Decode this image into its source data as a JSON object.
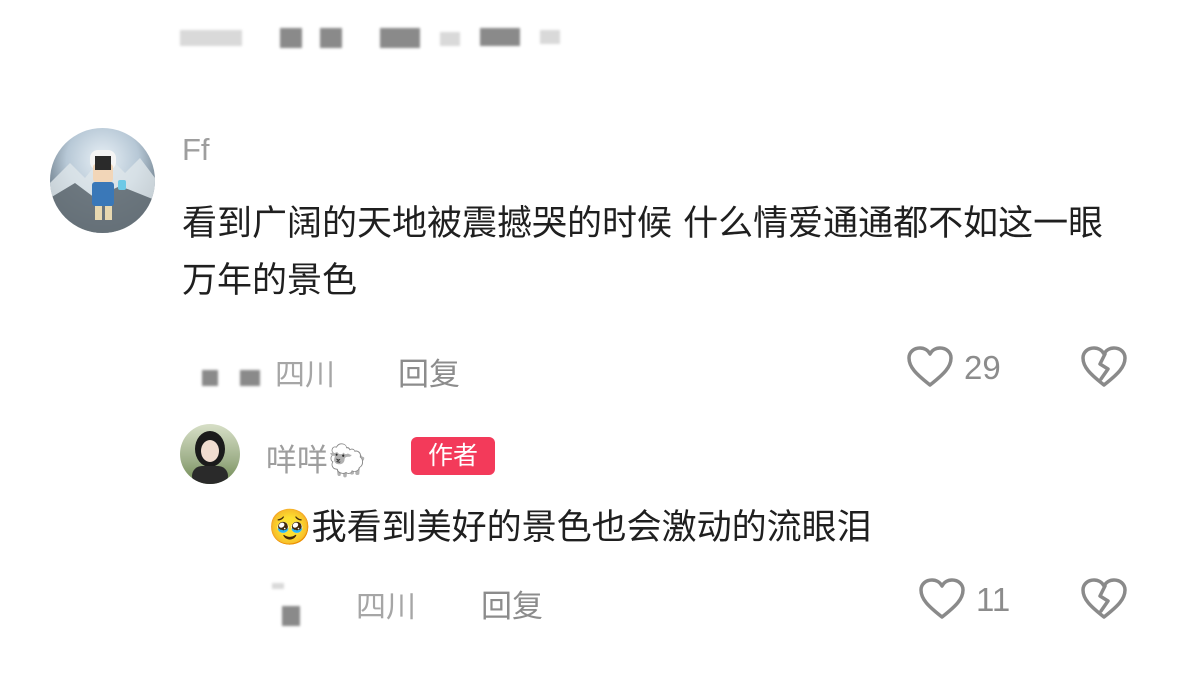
{
  "comment": {
    "username": "Ff",
    "text": "看到广阔的天地被震撼哭的时候 什么情爱通通都不如这一眼万年的景色",
    "location": "四川",
    "reply_label": "回复",
    "likes": "29",
    "icons": {
      "like": "heart-outline-icon",
      "dislike": "broken-heart-icon"
    }
  },
  "reply": {
    "username": "咩咩",
    "username_emoji": "🐑",
    "author_badge": "作者",
    "emoji": "🥹",
    "text": "我看到美好的景色也会激动的流眼泪",
    "location": "四川",
    "reply_label": "回复",
    "likes": "11",
    "icons": {
      "like": "heart-outline-icon",
      "dislike": "broken-heart-icon"
    }
  },
  "colors": {
    "badge": "#f33a5a",
    "text": "#1f1f1f",
    "muted": "#9e9e9e"
  }
}
